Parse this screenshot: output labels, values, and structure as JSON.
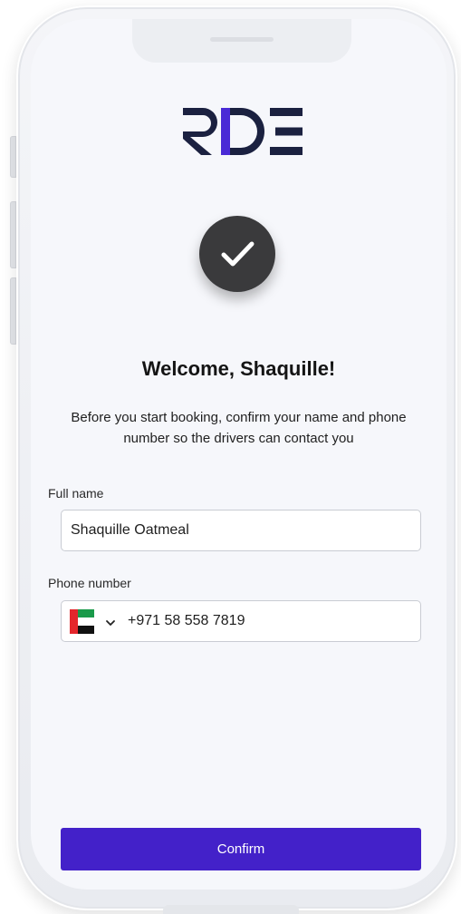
{
  "brand": {
    "logo_text": "RDE",
    "colors": {
      "logo_dark": "#1b2140",
      "logo_accent": "#4a2ad6",
      "primary_button": "#4321c9",
      "check_circle": "#3a3a3c"
    }
  },
  "status_icon": "checkmark-icon",
  "welcome": {
    "title": "Welcome, Shaquille!",
    "subtitle": "Before you start booking, confirm your name and phone number so the drivers can contact you"
  },
  "form": {
    "full_name": {
      "label": "Full name",
      "value": "Shaquille Oatmeal"
    },
    "phone": {
      "label": "Phone number",
      "country_flag": "uae-flag-icon",
      "value": "+971 58 558 7819"
    }
  },
  "actions": {
    "confirm_label": "Confirm"
  }
}
